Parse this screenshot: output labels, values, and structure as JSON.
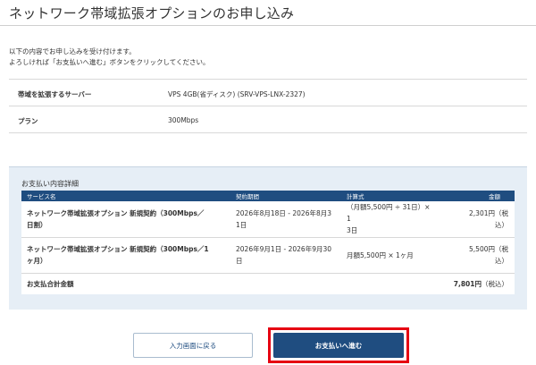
{
  "page": {
    "title": "ネットワーク帯域拡張オプションのお申し込み",
    "intro_line1": "以下の内容でお申し込みを受け付けます。",
    "intro_line2": "よろしければ「お支払いへ進む」ボタンをクリックしてください。"
  },
  "info": {
    "server_label": "帯域を拡張するサーバー",
    "server_value": "VPS 4GB(省ディスク) (SRV-VPS-LNX-2327)",
    "plan_label": "プラン",
    "plan_value": "300Mbps"
  },
  "payment": {
    "heading": "お支払い内容詳細",
    "columns": {
      "service": "サービス名",
      "period": "契約期間",
      "calc": "計算式",
      "amount": "金額"
    },
    "rows": [
      {
        "name_l1": "ネットワーク帯域拡張オプション 新規契約（300Mbps／",
        "name_l2": "日割）",
        "period_l1": "2026年8月18日 - 2026年8月3",
        "period_l2": "1日",
        "calc_l1": "（月額5,500円 ÷ 31日）× 1",
        "calc_l2": "3日",
        "amount_l1": "2,301円（税",
        "amount_l2": "込）"
      },
      {
        "name_l1": "ネットワーク帯域拡張オプション 新規契約（300Mbps／1",
        "name_l2": "ヶ月）",
        "period_l1": "2026年9月1日 - 2026年9月30",
        "period_l2": "日",
        "calc_l1": "月額5,500円 × 1ヶ月",
        "calc_l2": "",
        "amount_l1": "5,500円（税",
        "amount_l2": "込）"
      }
    ],
    "total_label": "お支払合計金額",
    "total_amount": "7,801円",
    "total_suffix": "（税込）"
  },
  "buttons": {
    "back": "入力画面に戻る",
    "proceed": "お支払いへ進む"
  },
  "colors": {
    "accent": "#1f4d80",
    "panel_bg": "#e6eef6",
    "highlight": "#e60012"
  }
}
